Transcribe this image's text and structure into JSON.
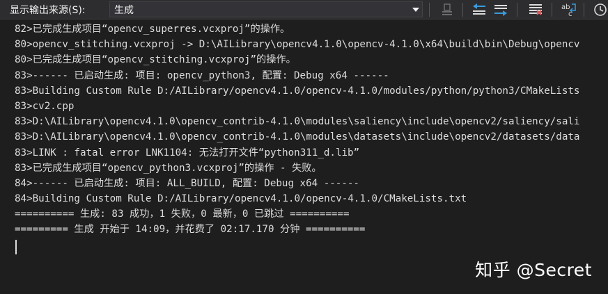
{
  "toolbar": {
    "source_label": "显示输出来源(S):",
    "source_value": "生成",
    "icons": [
      "chevron-down-icon",
      "clear-output-icon",
      "previous-message-icon",
      "next-message-icon",
      "clear-all-icon",
      "word-wrap-icon",
      "clock-icon"
    ]
  },
  "output": {
    "lines": [
      "82>已完成生成项目“opencv_superres.vcxproj”的操作。",
      "80>opencv_stitching.vcxproj -> D:\\AILibrary\\opencv4.1.0\\opencv-4.1.0\\x64\\build\\bin\\Debug\\opencv",
      "80>已完成生成项目“opencv_stitching.vcxproj”的操作。",
      "83>------ 已启动生成: 项目: opencv_python3, 配置: Debug x64 ------",
      "83>Building Custom Rule D:/AILibrary/opencv4.1.0/opencv-4.1.0/modules/python/python3/CMakeLists",
      "83>cv2.cpp",
      "83>D:\\AILibrary\\opencv4.1.0\\opencv_contrib-4.1.0\\modules\\saliency\\include\\opencv2/saliency/sali",
      "83>D:\\AILibrary\\opencv4.1.0\\opencv_contrib-4.1.0\\modules\\datasets\\include\\opencv2/datasets/data",
      "83>LINK : fatal error LNK1104: 无法打开文件“python311_d.lib”",
      "83>已完成生成项目“opencv_python3.vcxproj”的操作 - 失败。",
      "84>------ 已启动生成: 项目: ALL_BUILD, 配置: Debug x64 ------",
      "84>Building Custom Rule D:/AILibrary/opencv4.1.0/opencv-4.1.0/CMakeLists.txt",
      "========== 生成: 83 成功，1 失败，0 最新，0 已跳过 ==========",
      "========= 生成 开始于 14:09，并花费了 02:17.170 分钟 =========="
    ]
  },
  "watermark": "知乎 @Secret"
}
